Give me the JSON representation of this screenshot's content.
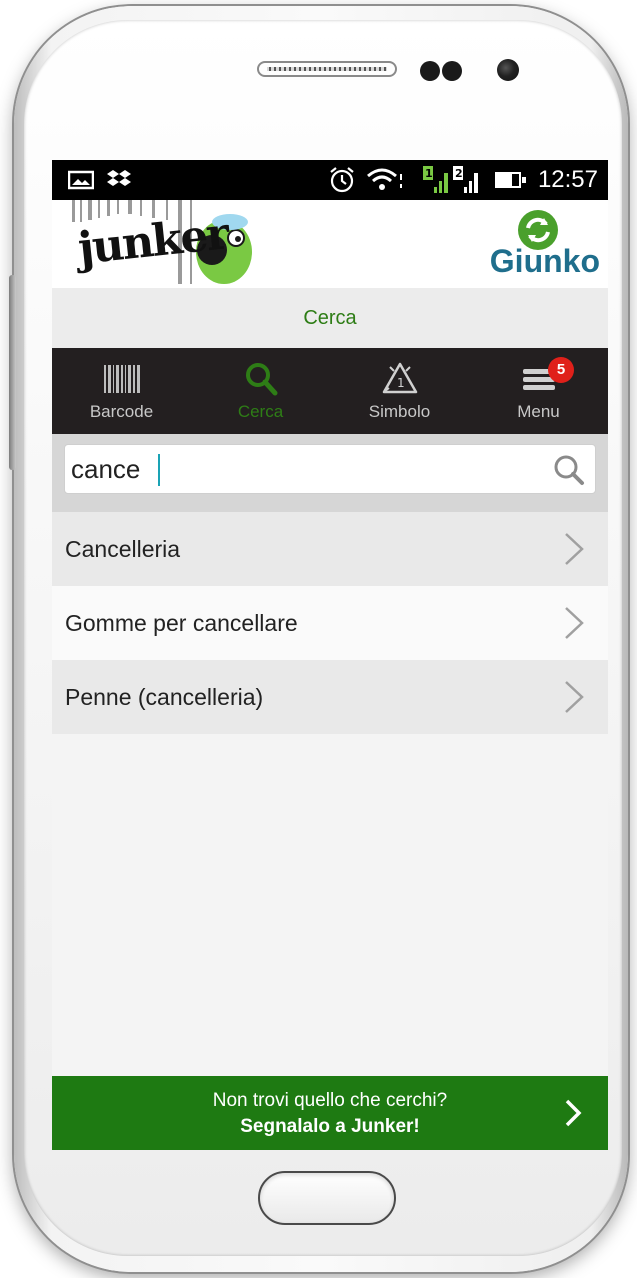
{
  "status_bar": {
    "time": "12:57",
    "left_icons": [
      "photo-icon",
      "dropbox-icon"
    ],
    "right_icons": [
      "alarm-icon",
      "wifi-icon",
      "sim1-signal-icon",
      "sim2-signal-icon",
      "battery-icon"
    ]
  },
  "header": {
    "left_logo_text": "junker",
    "right_logo_text": "Giunko"
  },
  "page_title": "Cerca",
  "nav": {
    "items": [
      {
        "label": "Barcode",
        "icon": "barcode-icon"
      },
      {
        "label": "Cerca",
        "icon": "search-icon",
        "active": true
      },
      {
        "label": "Simbolo",
        "icon": "recycle-symbol-icon"
      },
      {
        "label": "Menu",
        "icon": "menu-icon",
        "badge": "5"
      }
    ]
  },
  "search": {
    "value": "cance"
  },
  "results": [
    {
      "label": "Cancelleria"
    },
    {
      "label": "Gomme per cancellare"
    },
    {
      "label": "Penne (cancelleria)"
    }
  ],
  "footer": {
    "line1": "Non trovi quello che cerchi?",
    "line2": "Segnalalo a Junker!"
  },
  "colors": {
    "accent_green": "#2e7d16",
    "footer_green": "#1e7a12",
    "navbar_bg": "#231f20",
    "badge_red": "#e0201a"
  }
}
